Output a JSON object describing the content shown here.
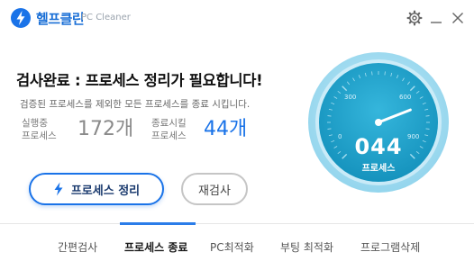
{
  "app": {
    "name": "헬프클린",
    "subtitle": "PC Cleaner"
  },
  "title_bar": {
    "icons": [
      "settings-icon",
      "minimize-icon",
      "close-icon"
    ]
  },
  "main": {
    "headline": "검사완료 : 프로세스 정리가 필요합니다!",
    "description": "검증된 프로세스를 제외한 모든 프로세스를 종료 시킵니다.",
    "stats": [
      {
        "label_line1": "실행중",
        "label_line2": "프로세스",
        "value": "172개"
      },
      {
        "label_line1": "종료시킬",
        "label_line2": "프로세스",
        "value": "44개"
      }
    ],
    "primary_button": "프로세스 정리",
    "secondary_button": "재검사"
  },
  "gauge": {
    "value_text": "044",
    "label": "프로세스",
    "ticks": [
      "0",
      "300",
      "600",
      "900"
    ],
    "value": 44,
    "max": 900
  },
  "tabs": [
    {
      "label": "간편검사",
      "active": false
    },
    {
      "label": "프로세스 종료",
      "active": true
    },
    {
      "label": "PC최적화",
      "active": false
    },
    {
      "label": "부팅 최적화",
      "active": false
    },
    {
      "label": "프로그램삭제",
      "active": false
    }
  ],
  "colors": {
    "brand": "#1a73e8",
    "gauge_outer": "#9fdcf0",
    "gauge_inner": "#1d9fc6",
    "accent_value": "#1a73e8"
  }
}
